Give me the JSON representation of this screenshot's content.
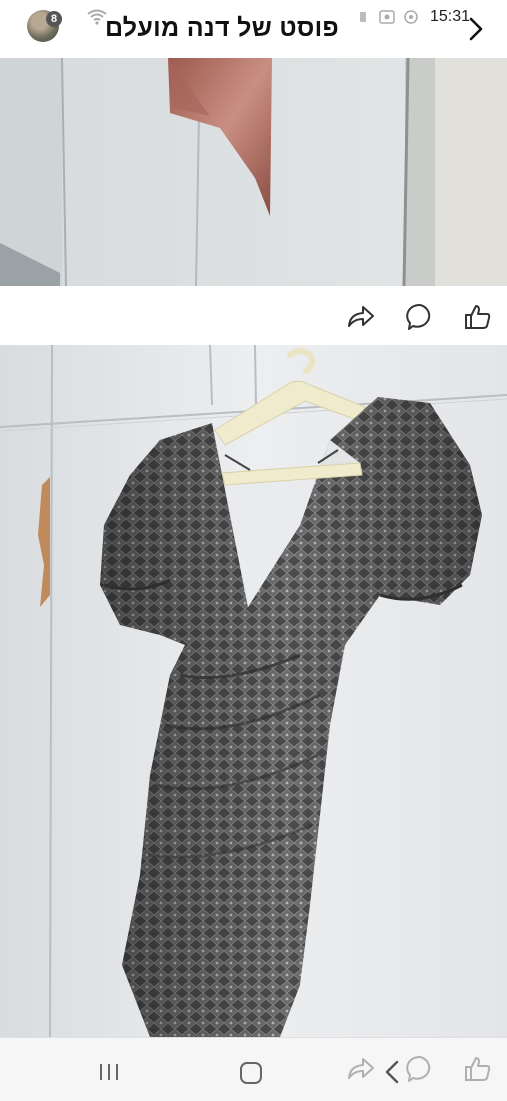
{
  "status_bar": {
    "time": "15:31",
    "notification_count": "8"
  },
  "header": {
    "title": "פוסט של דנה  מועלם"
  },
  "photos": [
    {
      "name": "wardrobe-photo"
    },
    {
      "name": "sequin-dress-photo"
    }
  ],
  "actions": [
    "share-icon",
    "comment-icon",
    "like-icon"
  ],
  "navigation": [
    "recent-apps-icon",
    "home-icon",
    "back-icon"
  ],
  "colors": {
    "icon": "#333333",
    "bottom_icon": "#b0b0b0"
  }
}
